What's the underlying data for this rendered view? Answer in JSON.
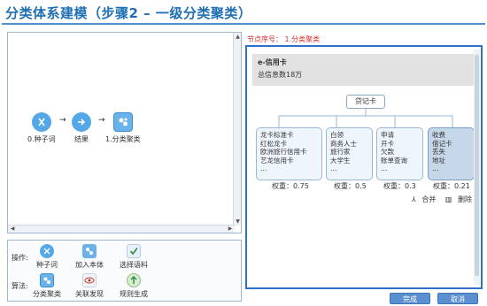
{
  "title": "分类体系建模（步骤2 – 一级分类聚类）",
  "flow": {
    "nodes": [
      {
        "label": "0.种子词",
        "icon": "seed-icon"
      },
      {
        "label": "结果",
        "icon": "result-arrow-icon"
      },
      {
        "label": "1.分类聚类",
        "icon": "cluster-icon"
      }
    ]
  },
  "toolbox": {
    "ops_label": "操作:",
    "algo_label": "算法:",
    "ops": [
      {
        "label": "种子词",
        "icon": "seed-icon"
      },
      {
        "label": "加入本体",
        "icon": "add-ontology-icon"
      },
      {
        "label": "选择语料",
        "icon": "select-corpus-icon"
      }
    ],
    "algos": [
      {
        "label": "分类聚类",
        "icon": "cluster-icon"
      },
      {
        "label": "关联发现",
        "icon": "eye-icon"
      },
      {
        "label": "规则生成",
        "icon": "rule-icon"
      }
    ]
  },
  "node_number": "节点序号：  1.分类聚类",
  "info": {
    "name": "e-信用卡",
    "total": "总信息数18万"
  },
  "root_label": "贷记卡",
  "clusters": [
    {
      "lines": [
        "龙卡标准卡",
        "红松龙卡",
        "欧洲旅行信用卡",
        "艺龙信用卡",
        "…"
      ],
      "weight": "权重：0.75",
      "selected": false
    },
    {
      "lines": [
        "白领",
        "商务人士",
        "旅行家",
        "大学生",
        "…"
      ],
      "weight": "权重：0.5",
      "selected": false
    },
    {
      "lines": [
        "申请",
        "开卡",
        "欠款",
        "账单查询",
        "…"
      ],
      "weight": "权重：0.3",
      "selected": false
    },
    {
      "lines": [
        "收费",
        "借记卡",
        "丢失",
        "地址",
        "…"
      ],
      "weight": "权重：0.21",
      "selected": true
    }
  ],
  "actions": {
    "merge": "合并",
    "delete": "删除"
  },
  "buttons": {
    "finish": "完成",
    "cancel": "取消"
  }
}
